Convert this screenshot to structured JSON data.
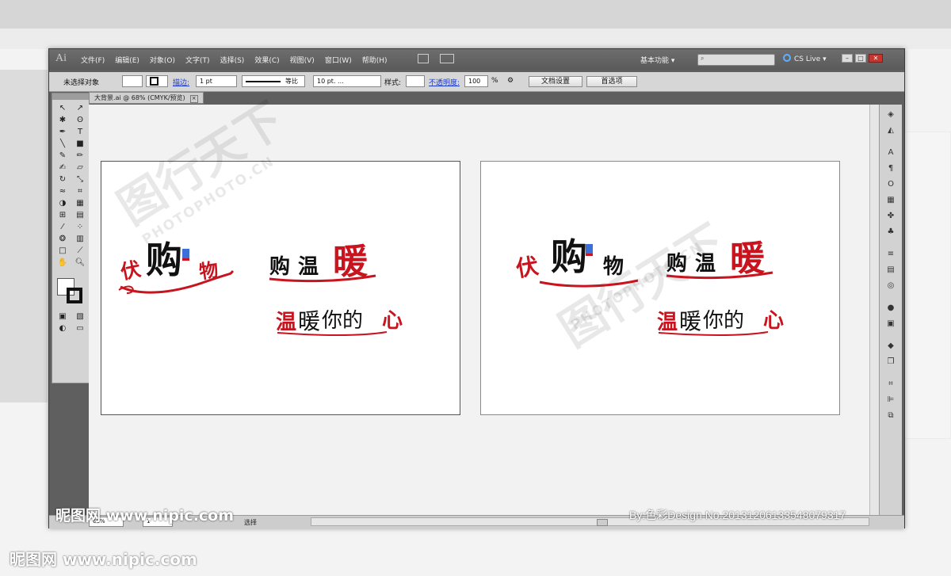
{
  "menu_items": [
    "文件(F)",
    "编辑(E)",
    "对象(O)",
    "文字(T)",
    "选择(S)",
    "效果(C)",
    "视图(V)",
    "窗口(W)",
    "帮助(H)"
  ],
  "app_logo": "Ai",
  "workspace_label": "基本功能 ▾",
  "cs_live": "CS Live ▾",
  "control": {
    "no_selection": "未选择对象",
    "stroke_label": "描边:",
    "stroke_weight": "1 pt",
    "stroke_profile": "等比",
    "brush": "10 pt. ...",
    "style_label": "样式:",
    "opacity_label": "不透明度:",
    "opacity_value": "100",
    "percent": "%",
    "doc_setup": "文档设置",
    "preferences": "首选项"
  },
  "document_tab": "大背景.ai @ 68% (CMYK/预览)",
  "status": {
    "zoom": "68%",
    "page": "1",
    "tool": "选择"
  },
  "artwork": {
    "left_logo": {
      "a": "伏",
      "b": "购",
      "c": "物"
    },
    "warm_title": {
      "a": "购",
      "b": "温",
      "c": "暖"
    },
    "warm_sub": {
      "a": "温",
      "b": "暖",
      "c": "你的",
      "d": "心"
    },
    "right_logo": {
      "a": "伏",
      "b": "购",
      "c": "物"
    }
  },
  "watermarks": {
    "site": "昵图网 www.nipic.com",
    "id": "By:色彩Design No.20131206133548079317",
    "art_cn": "图行天下",
    "art_en": "PHOTOPHOTO.CN"
  },
  "colors": {
    "red": "#c8141e",
    "black": "#111111",
    "panel": "#d4d4d4",
    "frame": "#5f5f5f"
  }
}
